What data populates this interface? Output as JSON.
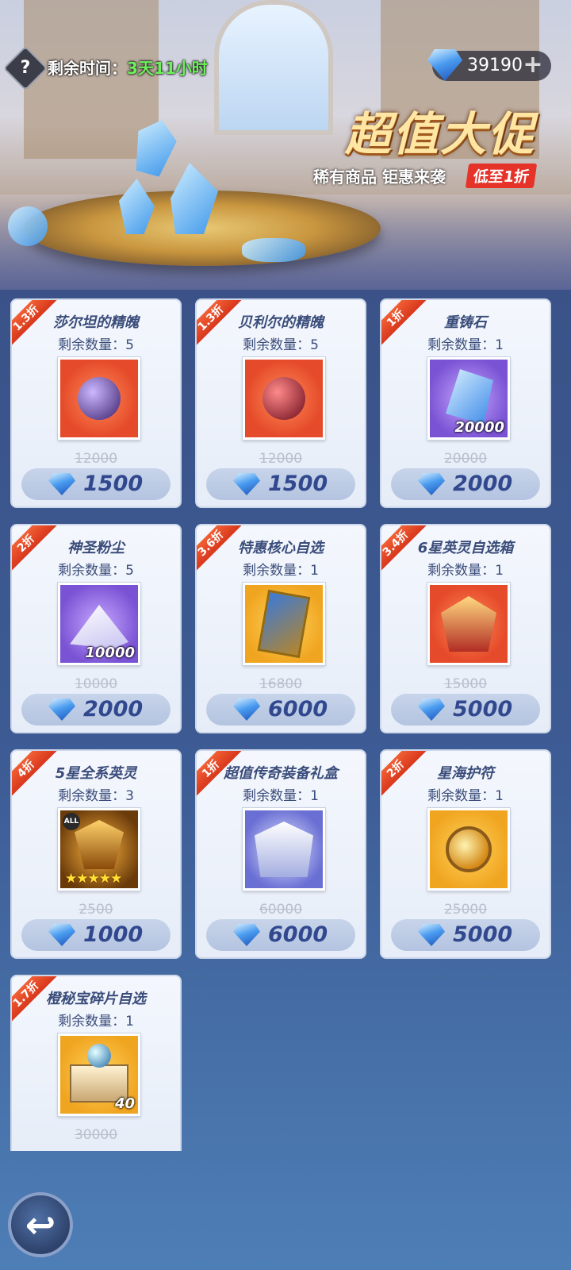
{
  "header": {
    "help_icon": "?",
    "timer_label": "剩余时间：",
    "timer_value": "3天11小时",
    "currency_amount": "39190",
    "plus_icon": "+"
  },
  "promo": {
    "title": "超值大促",
    "subtitle": "稀有商品 钜惠来袭",
    "tag": "低至1折"
  },
  "items": [
    {
      "discount": "1.3折",
      "name": "莎尔坦的精魄",
      "stock": "剩余数量：5",
      "qty": "",
      "old_price": "12000",
      "price": "1500"
    },
    {
      "discount": "1.3折",
      "name": "贝利尔的精魄",
      "stock": "剩余数量：5",
      "qty": "",
      "old_price": "12000",
      "price": "1500"
    },
    {
      "discount": "1折",
      "name": "重铸石",
      "stock": "剩余数量：1",
      "qty": "20000",
      "old_price": "20000",
      "price": "2000"
    },
    {
      "discount": "2折",
      "name": "神圣粉尘",
      "stock": "剩余数量：5",
      "qty": "10000",
      "old_price": "10000",
      "price": "2000"
    },
    {
      "discount": "3.6折",
      "name": "特惠核心自选",
      "stock": "剩余数量：1",
      "qty": "",
      "old_price": "16800",
      "price": "6000"
    },
    {
      "discount": "3.4折",
      "name": "6星英灵自选箱",
      "stock": "剩余数量：1",
      "qty": "",
      "old_price": "15000",
      "price": "5000"
    },
    {
      "discount": "4折",
      "name": "5星全系英灵",
      "stock": "剩余数量：3",
      "qty": "",
      "old_price": "2500",
      "price": "1000",
      "all_tag": "ALL",
      "stars": "★★★★★"
    },
    {
      "discount": "1折",
      "name": "超值传奇装备礼盒",
      "stock": "剩余数量：1",
      "qty": "",
      "old_price": "60000",
      "price": "6000"
    },
    {
      "discount": "2折",
      "name": "星海护符",
      "stock": "剩余数量：1",
      "qty": "",
      "old_price": "25000",
      "price": "5000"
    },
    {
      "discount": "1.7折",
      "name": "橙秘宝碎片自选",
      "stock": "剩余数量：1",
      "qty": "40",
      "old_price": "30000",
      "price": ""
    }
  ],
  "back_icon": "↩"
}
